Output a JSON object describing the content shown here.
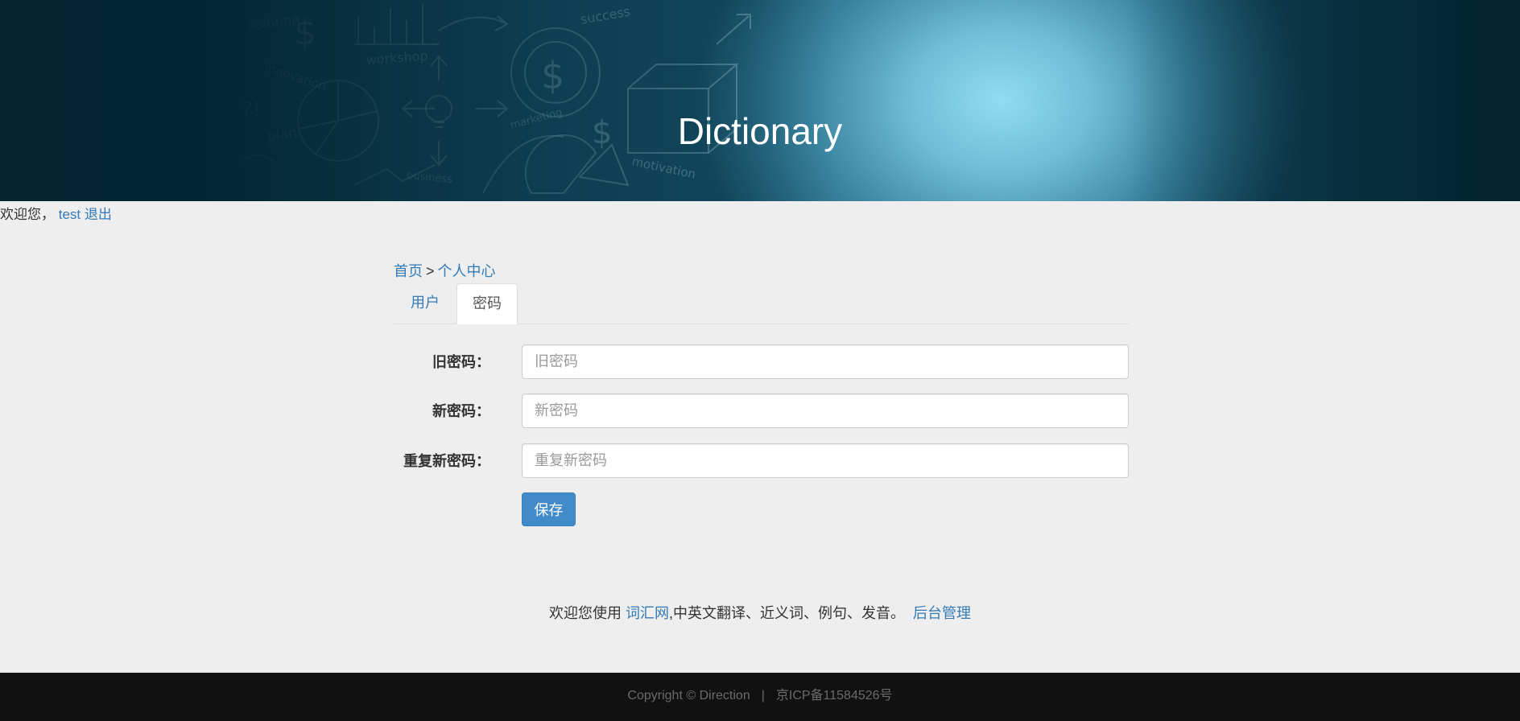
{
  "banner": {
    "title": "Dictionary",
    "doodle_words": [
      "solution",
      "innovation",
      "plan",
      "workshop",
      "success",
      "marketing",
      "business",
      "motivation"
    ],
    "colors": {
      "dark": "#052c3b",
      "glow": "#8fdcf3"
    }
  },
  "welcome": {
    "prefix": "欢迎您，",
    "username": "test",
    "logout": "退出"
  },
  "breadcrumb": {
    "home": "首页",
    "separator": ">",
    "current": "个人中心"
  },
  "tabs": [
    {
      "label": "用户",
      "active": false
    },
    {
      "label": "密码",
      "active": true
    }
  ],
  "form": {
    "old_password": {
      "label": "旧密码：",
      "placeholder": "旧密码",
      "value": ""
    },
    "new_password": {
      "label": "新密码：",
      "placeholder": "新密码",
      "value": ""
    },
    "repeat_password": {
      "label": "重复新密码：",
      "placeholder": "重复新密码",
      "value": ""
    },
    "save_label": "保存"
  },
  "info": {
    "prefix": "欢迎您使用",
    "site_link": "词汇网",
    "description": ",中英文翻译、近义词、例句、发音。",
    "admin_link": "后台管理"
  },
  "footer": {
    "copyright": "Copyright © Direction",
    "separator": "|",
    "icp": "京ICP备11584526号"
  },
  "colors": {
    "link": "#337ab7",
    "primary_button": "#428bca",
    "page_background": "#eeeeee",
    "footer_background": "#111111"
  }
}
